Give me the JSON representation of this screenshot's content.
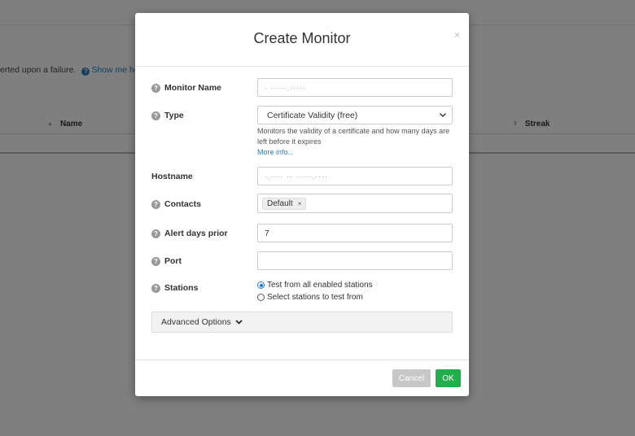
{
  "background": {
    "description_text": "erted upon a failure.",
    "help_link": "Show me help",
    "columns": {
      "name": "Name",
      "streak": "Streak"
    }
  },
  "modal": {
    "title": "Create Monitor",
    "close": "×",
    "fields": {
      "monitor_name": {
        "label": "Monitor Name",
        "value": "· ·····.·····"
      },
      "type": {
        "label": "Type",
        "value": "Certificate Validity (free)",
        "hint": "Monitors the validity of a certificate and how many days are left before it expires",
        "more_info": "More info..."
      },
      "hostname": {
        "label": "Hostname",
        "value": "·.···· ·· ·····.····"
      },
      "contacts": {
        "label": "Contacts",
        "chip": "Default",
        "chip_remove": "×"
      },
      "alert_days_prior": {
        "label": "Alert days prior",
        "value": "7"
      },
      "port": {
        "label": "Port",
        "value": ""
      },
      "stations": {
        "label": "Stations",
        "options": [
          "Test from all enabled stations",
          "Select stations to test from"
        ],
        "selected_index": 0
      }
    },
    "advanced_label": "Advanced Options",
    "buttons": {
      "cancel": "Cancel",
      "ok": "OK"
    }
  },
  "colors": {
    "ok_green": "#1fb04c",
    "cancel_gray": "#c7c7c7",
    "link_blue": "#2a7ab8",
    "radio_blue": "#1a73e8"
  }
}
